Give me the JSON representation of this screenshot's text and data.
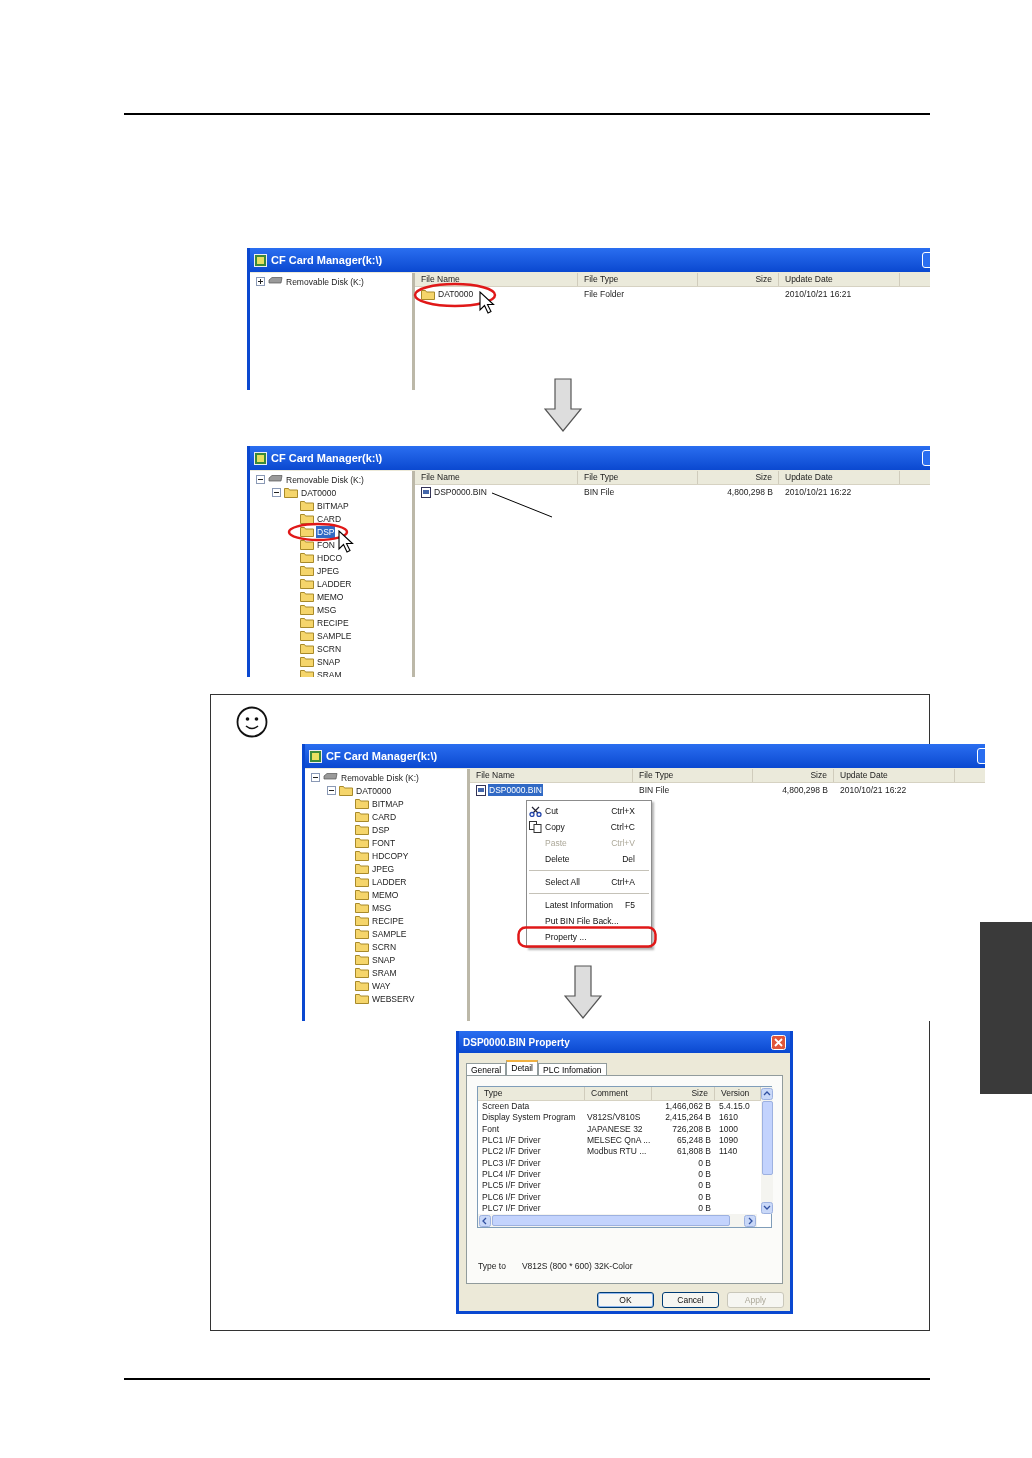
{
  "screens": [
    {
      "title": "CF Card Manager(k:\\)",
      "tree": [
        {
          "kind": "drive",
          "label": "Removable Disk (K:)",
          "expanded": false,
          "selected": false
        }
      ],
      "columns": [
        "File Name",
        "File Type",
        "Size",
        "Update Date"
      ],
      "rows": [
        {
          "kind": "folder",
          "name": "DAT0000",
          "type": "File Folder",
          "date": "2010/10/21 16:21",
          "selected": false,
          "circled": true,
          "pointer": true
        }
      ]
    },
    {
      "title": "CF Card Manager(k:\\)",
      "tree": [
        {
          "kind": "drive",
          "label": "Removable Disk (K:)",
          "expanded": true,
          "selected": false,
          "children": [
            {
              "kind": "folder",
              "label": "DAT0000",
              "expanded": true,
              "selected": false,
              "children": [
                {
                  "kind": "folder",
                  "label": "BITMAP",
                  "selected": false
                },
                {
                  "kind": "folder",
                  "label": "CARD",
                  "selected": false
                },
                {
                  "kind": "folder",
                  "label": "DSP",
                  "selected": true,
                  "circled": true,
                  "pointer": true
                },
                {
                  "kind": "folder",
                  "label": "FON",
                  "selected": false
                },
                {
                  "kind": "folder",
                  "label": "HDCO",
                  "selected": false
                },
                {
                  "kind": "folder",
                  "label": "JPEG",
                  "selected": false
                },
                {
                  "kind": "folder",
                  "label": "LADDER",
                  "selected": false
                },
                {
                  "kind": "folder",
                  "label": "MEMO",
                  "selected": false
                },
                {
                  "kind": "folder",
                  "label": "MSG",
                  "selected": false
                },
                {
                  "kind": "folder",
                  "label": "RECIPE",
                  "selected": false
                },
                {
                  "kind": "folder",
                  "label": "SAMPLE",
                  "selected": false
                },
                {
                  "kind": "folder",
                  "label": "SCRN",
                  "selected": false
                },
                {
                  "kind": "folder",
                  "label": "SNAP",
                  "selected": false
                },
                {
                  "kind": "folder",
                  "label": "SRAM",
                  "selected": false
                }
              ]
            }
          ]
        }
      ],
      "columns": [
        "File Name",
        "File Type",
        "Size",
        "Update Date"
      ],
      "rows": [
        {
          "kind": "file",
          "name": "DSP0000.BIN",
          "type": "BIN File",
          "size": "4,800,298 B",
          "date": "2010/10/21 16:22",
          "selected": false,
          "leader": true
        }
      ]
    },
    {
      "title": "CF Card Manager(k:\\)",
      "tree": [
        {
          "kind": "drive",
          "label": "Removable Disk (K:)",
          "expanded": true,
          "selected": false,
          "children": [
            {
              "kind": "folder",
              "label": "DAT0000",
              "expanded": true,
              "selected": false,
              "children": [
                {
                  "kind": "folder",
                  "label": "BITMAP",
                  "selected": false
                },
                {
                  "kind": "folder",
                  "label": "CARD",
                  "selected": false
                },
                {
                  "kind": "folder",
                  "label": "DSP",
                  "selected": false
                },
                {
                  "kind": "folder",
                  "label": "FONT",
                  "selected": false
                },
                {
                  "kind": "folder",
                  "label": "HDCOPY",
                  "selected": false
                },
                {
                  "kind": "folder",
                  "label": "JPEG",
                  "selected": false
                },
                {
                  "kind": "folder",
                  "label": "LADDER",
                  "selected": false
                },
                {
                  "kind": "folder",
                  "label": "MEMO",
                  "selected": false
                },
                {
                  "kind": "folder",
                  "label": "MSG",
                  "selected": false
                },
                {
                  "kind": "folder",
                  "label": "RECIPE",
                  "selected": false
                },
                {
                  "kind": "folder",
                  "label": "SAMPLE",
                  "selected": false
                },
                {
                  "kind": "folder",
                  "label": "SCRN",
                  "selected": false
                },
                {
                  "kind": "folder",
                  "label": "SNAP",
                  "selected": false
                },
                {
                  "kind": "folder",
                  "label": "SRAM",
                  "selected": false
                },
                {
                  "kind": "folder",
                  "label": "WAY",
                  "selected": false
                },
                {
                  "kind": "folder",
                  "label": "WEBSERV",
                  "selected": false
                }
              ]
            }
          ]
        }
      ],
      "columns": [
        "File Name",
        "File Type",
        "Size",
        "Update Date"
      ],
      "rows": [
        {
          "kind": "file",
          "name": "DSP0000.BIN",
          "type": "BIN File",
          "size": "4,800,298 B",
          "date": "2010/10/21 16:22",
          "selected": true
        }
      ],
      "context_menu": [
        {
          "kind": "cut",
          "label": "Cut",
          "shortcut": "Ctrl+X",
          "disabled": false,
          "circled": false
        },
        {
          "kind": "copy",
          "label": "Copy",
          "shortcut": "Ctrl+C",
          "disabled": false,
          "circled": false
        },
        {
          "kind": "item",
          "label": "Paste",
          "shortcut": "Ctrl+V",
          "disabled": true,
          "circled": false
        },
        {
          "kind": "item",
          "label": "Delete",
          "shortcut": "Del",
          "disabled": false,
          "circled": false
        },
        {
          "kind": "separator"
        },
        {
          "kind": "item",
          "label": "Select All",
          "shortcut": "Ctrl+A",
          "disabled": false,
          "circled": false
        },
        {
          "kind": "separator"
        },
        {
          "kind": "item",
          "label": "Latest Information",
          "shortcut": "F5",
          "disabled": false,
          "circled": false
        },
        {
          "kind": "item",
          "label": "Put BIN File Back...",
          "disabled": false,
          "circled": false
        },
        {
          "kind": "item",
          "label": "Property ...",
          "disabled": false,
          "circled": true
        }
      ]
    }
  ],
  "dialog": {
    "title": "DSP0000.BIN Property",
    "tabs": [
      {
        "label": "General",
        "selected": false
      },
      {
        "label": "Detail",
        "selected": true
      },
      {
        "label": "PLC Infomation",
        "selected": false
      }
    ],
    "columns": [
      "Type",
      "Comment",
      "Size",
      "Version"
    ],
    "rows": [
      {
        "type": "Screen Data",
        "size": "1,466,062 B",
        "version": "5.4.15.0"
      },
      {
        "type": "Display System Program",
        "comment": "V812S/V810S",
        "size": "2,415,264 B",
        "version": "1610"
      },
      {
        "type": "Font",
        "comment": "JAPANESE 32",
        "size": "726,208 B",
        "version": "1000"
      },
      {
        "type": "PLC1 I/F Driver",
        "comment": "MELSEC QnA ...",
        "size": "65,248 B",
        "version": "1090"
      },
      {
        "type": "PLC2 I/F Driver",
        "comment": "Modbus RTU ...",
        "size": "61,808 B",
        "version": "1140"
      },
      {
        "type": "PLC3 I/F Driver",
        "size": "0 B"
      },
      {
        "type": "PLC4 I/F Driver",
        "size": "0 B"
      },
      {
        "type": "PLC5 I/F Driver",
        "size": "0 B"
      },
      {
        "type": "PLC6 I/F Driver",
        "size": "0 B"
      },
      {
        "type": "PLC7 I/F Driver",
        "size": "0 B"
      }
    ],
    "type_to_label": "Type to",
    "type_to_value": "V812S (800 * 600) 32K-Color",
    "buttons": [
      {
        "label": "OK",
        "disabled": false,
        "default": true
      },
      {
        "label": "Cancel",
        "disabled": false,
        "default": false
      },
      {
        "label": "Apply",
        "disabled": true,
        "default": false
      }
    ]
  }
}
